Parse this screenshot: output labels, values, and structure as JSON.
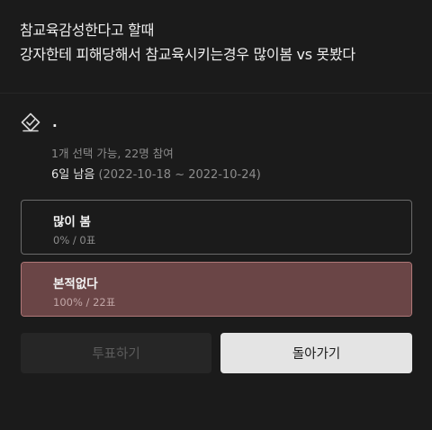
{
  "post": {
    "title_line1": "참교육감성한다고 할때",
    "title_line2": "강자한테 피해당해서 참교육시키는경우 많이봄 vs 못봤다"
  },
  "poll": {
    "icon": "check-diamond-icon",
    "name": ".",
    "meta": "1개 선택 가능, 22명 참여",
    "deadline_label": "6일 남음",
    "deadline_range": "(2022-10-18 ~ 2022-10-24)",
    "options": [
      {
        "label": "많이 봄",
        "stats": "0% / 0표",
        "fraction": 0
      },
      {
        "label": "본적없다",
        "stats": "100% / 22표",
        "fraction": 1
      }
    ]
  },
  "buttons": {
    "vote_label": "투표하기",
    "back_label": "돌아가기"
  },
  "colors": {
    "background": "#1b1b1b",
    "selected_fill": "#6a4546",
    "back_button": "#e4e4e4"
  }
}
